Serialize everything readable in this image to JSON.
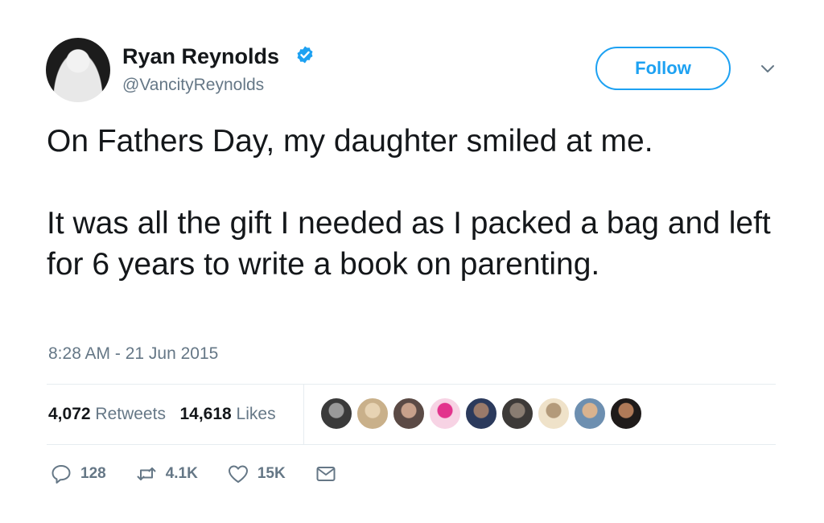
{
  "author": {
    "name": "Ryan Reynolds",
    "handle": "@VancityReynolds",
    "verified": true
  },
  "header": {
    "follow_label": "Follow"
  },
  "tweet": {
    "line1": "On Fathers Day, my daughter smiled at me.",
    "line2": "It was all the gift I needed as I packed a bag and left for 6 years to write a book on parenting."
  },
  "timestamp": "8:28 AM - 21 Jun 2015",
  "stats": {
    "retweets_count": "4,072",
    "retweets_label": "Retweets",
    "likes_count": "14,618",
    "likes_label": "Likes"
  },
  "likers": [
    {
      "color": "#3a3a3a",
      "accent": "#9a9a9a"
    },
    {
      "color": "#c9b08a",
      "accent": "#e7d3b3"
    },
    {
      "color": "#5b4a45",
      "accent": "#c8a18b"
    },
    {
      "color": "#f7d3e4",
      "accent": "#e2338c"
    },
    {
      "color": "#2b3a5c",
      "accent": "#9a7a6a"
    },
    {
      "color": "#3d3a38",
      "accent": "#8a7d72"
    },
    {
      "color": "#efe2c9",
      "accent": "#b39a7a"
    },
    {
      "color": "#6d8fb0",
      "accent": "#d9b38f"
    },
    {
      "color": "#1f1b1a",
      "accent": "#b07a58"
    }
  ],
  "actions": {
    "replies": "128",
    "retweets": "4.1K",
    "likes": "15K"
  },
  "colors": {
    "accent": "#1da1f2",
    "text": "#14171a",
    "secondary": "#657786",
    "divider": "#e6ecf0"
  }
}
